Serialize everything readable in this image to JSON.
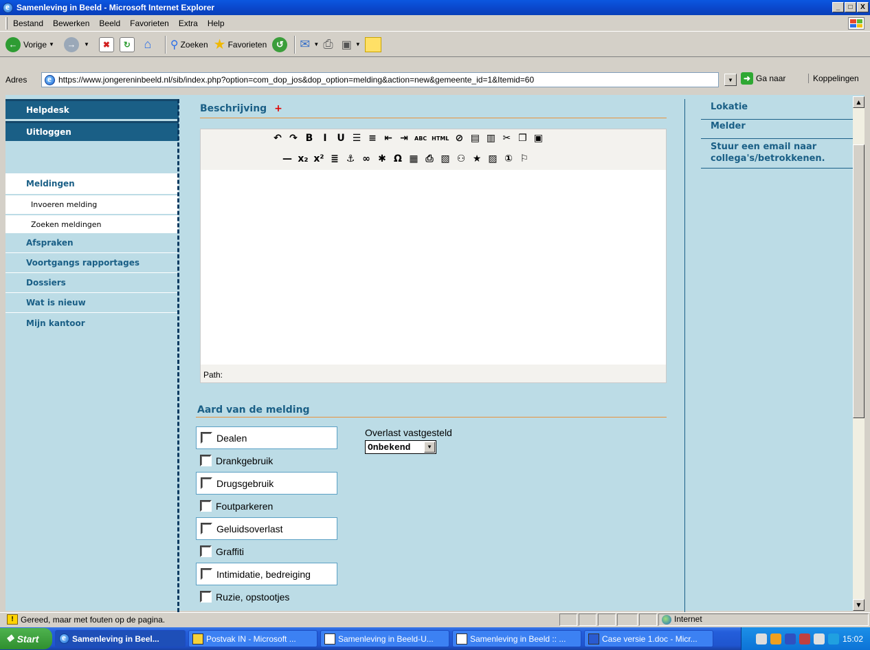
{
  "window": {
    "title": "Samenleving in Beeld - Microsoft Internet Explorer",
    "buttons": [
      "_",
      "□",
      "X"
    ]
  },
  "menu": [
    "Bestand",
    "Bewerken",
    "Beeld",
    "Favorieten",
    "Extra",
    "Help"
  ],
  "toolbar": {
    "back_label": "Vorige",
    "search_label": "Zoeken",
    "favorites_label": "Favorieten"
  },
  "address": {
    "label": "Adres",
    "url": "https://www.jongereninbeeld.nl/sib/index.php?option=com_dop_jos&dop_option=melding&action=new&gemeente_id=1&Itemid=60",
    "go_label": "Ga naar",
    "links_label": "Koppelingen"
  },
  "leftnav": {
    "top_items": [
      "Helpdesk",
      "Uitloggen"
    ],
    "section": "Meldingen",
    "sub_items": [
      "Invoeren melding",
      "Zoeken meldingen"
    ],
    "items": [
      "Afspraken",
      "Voortgangs rapportages",
      "Dossiers",
      "Wat is nieuw",
      "Mijn kantoor"
    ]
  },
  "main": {
    "description_title": "Beschrijving",
    "required_mark": "+",
    "editor_path_label": "Path:",
    "editor_row1": [
      "↶",
      "↷",
      "B",
      "I",
      "U",
      "☰",
      "≡",
      "⇤",
      "⇥",
      "ABC",
      "HTML",
      "⊘",
      "▤",
      "▥",
      "✂",
      "❐",
      "▣"
    ],
    "editor_row2": [
      "—",
      "x₂",
      "x²",
      "≣",
      "⚓",
      "∞",
      "✱",
      "Ω",
      "▦",
      "⎙",
      "▧",
      "⚇",
      "★",
      "▨",
      "①",
      "⚐"
    ],
    "type_title": "Aard van de melding",
    "checkboxes": [
      "Dealen",
      "Drankgebruik",
      "Drugsgebruik",
      "Foutparkeren",
      "Geluidsoverlast",
      "Graffiti",
      "Intimidatie, bedreiging",
      "Ruzie, opstootjes"
    ],
    "overlast_label": "Overlast vastgesteld",
    "overlast_value": "Onbekend"
  },
  "rightpanel": [
    "Lokatie",
    "Melder",
    "Stuur een email naar collega's/betrokkenen."
  ],
  "status": {
    "text": "Gereed, maar met fouten op de pagina.",
    "zone": "Internet"
  },
  "taskbar": {
    "start": "Start",
    "tasks": [
      "Samenleving in Beel...",
      "Postvak IN - Microsoft ...",
      "Samenleving in Beeld-U...",
      "Samenleving in Beeld :: ...",
      "Case versie 1.doc - Micr..."
    ],
    "clock": "15:02"
  },
  "colors": {
    "nav_dark": "#1a5f86",
    "page_bg": "#bcdce6",
    "accent_line": "#e8923c",
    "required": "#e00000"
  }
}
